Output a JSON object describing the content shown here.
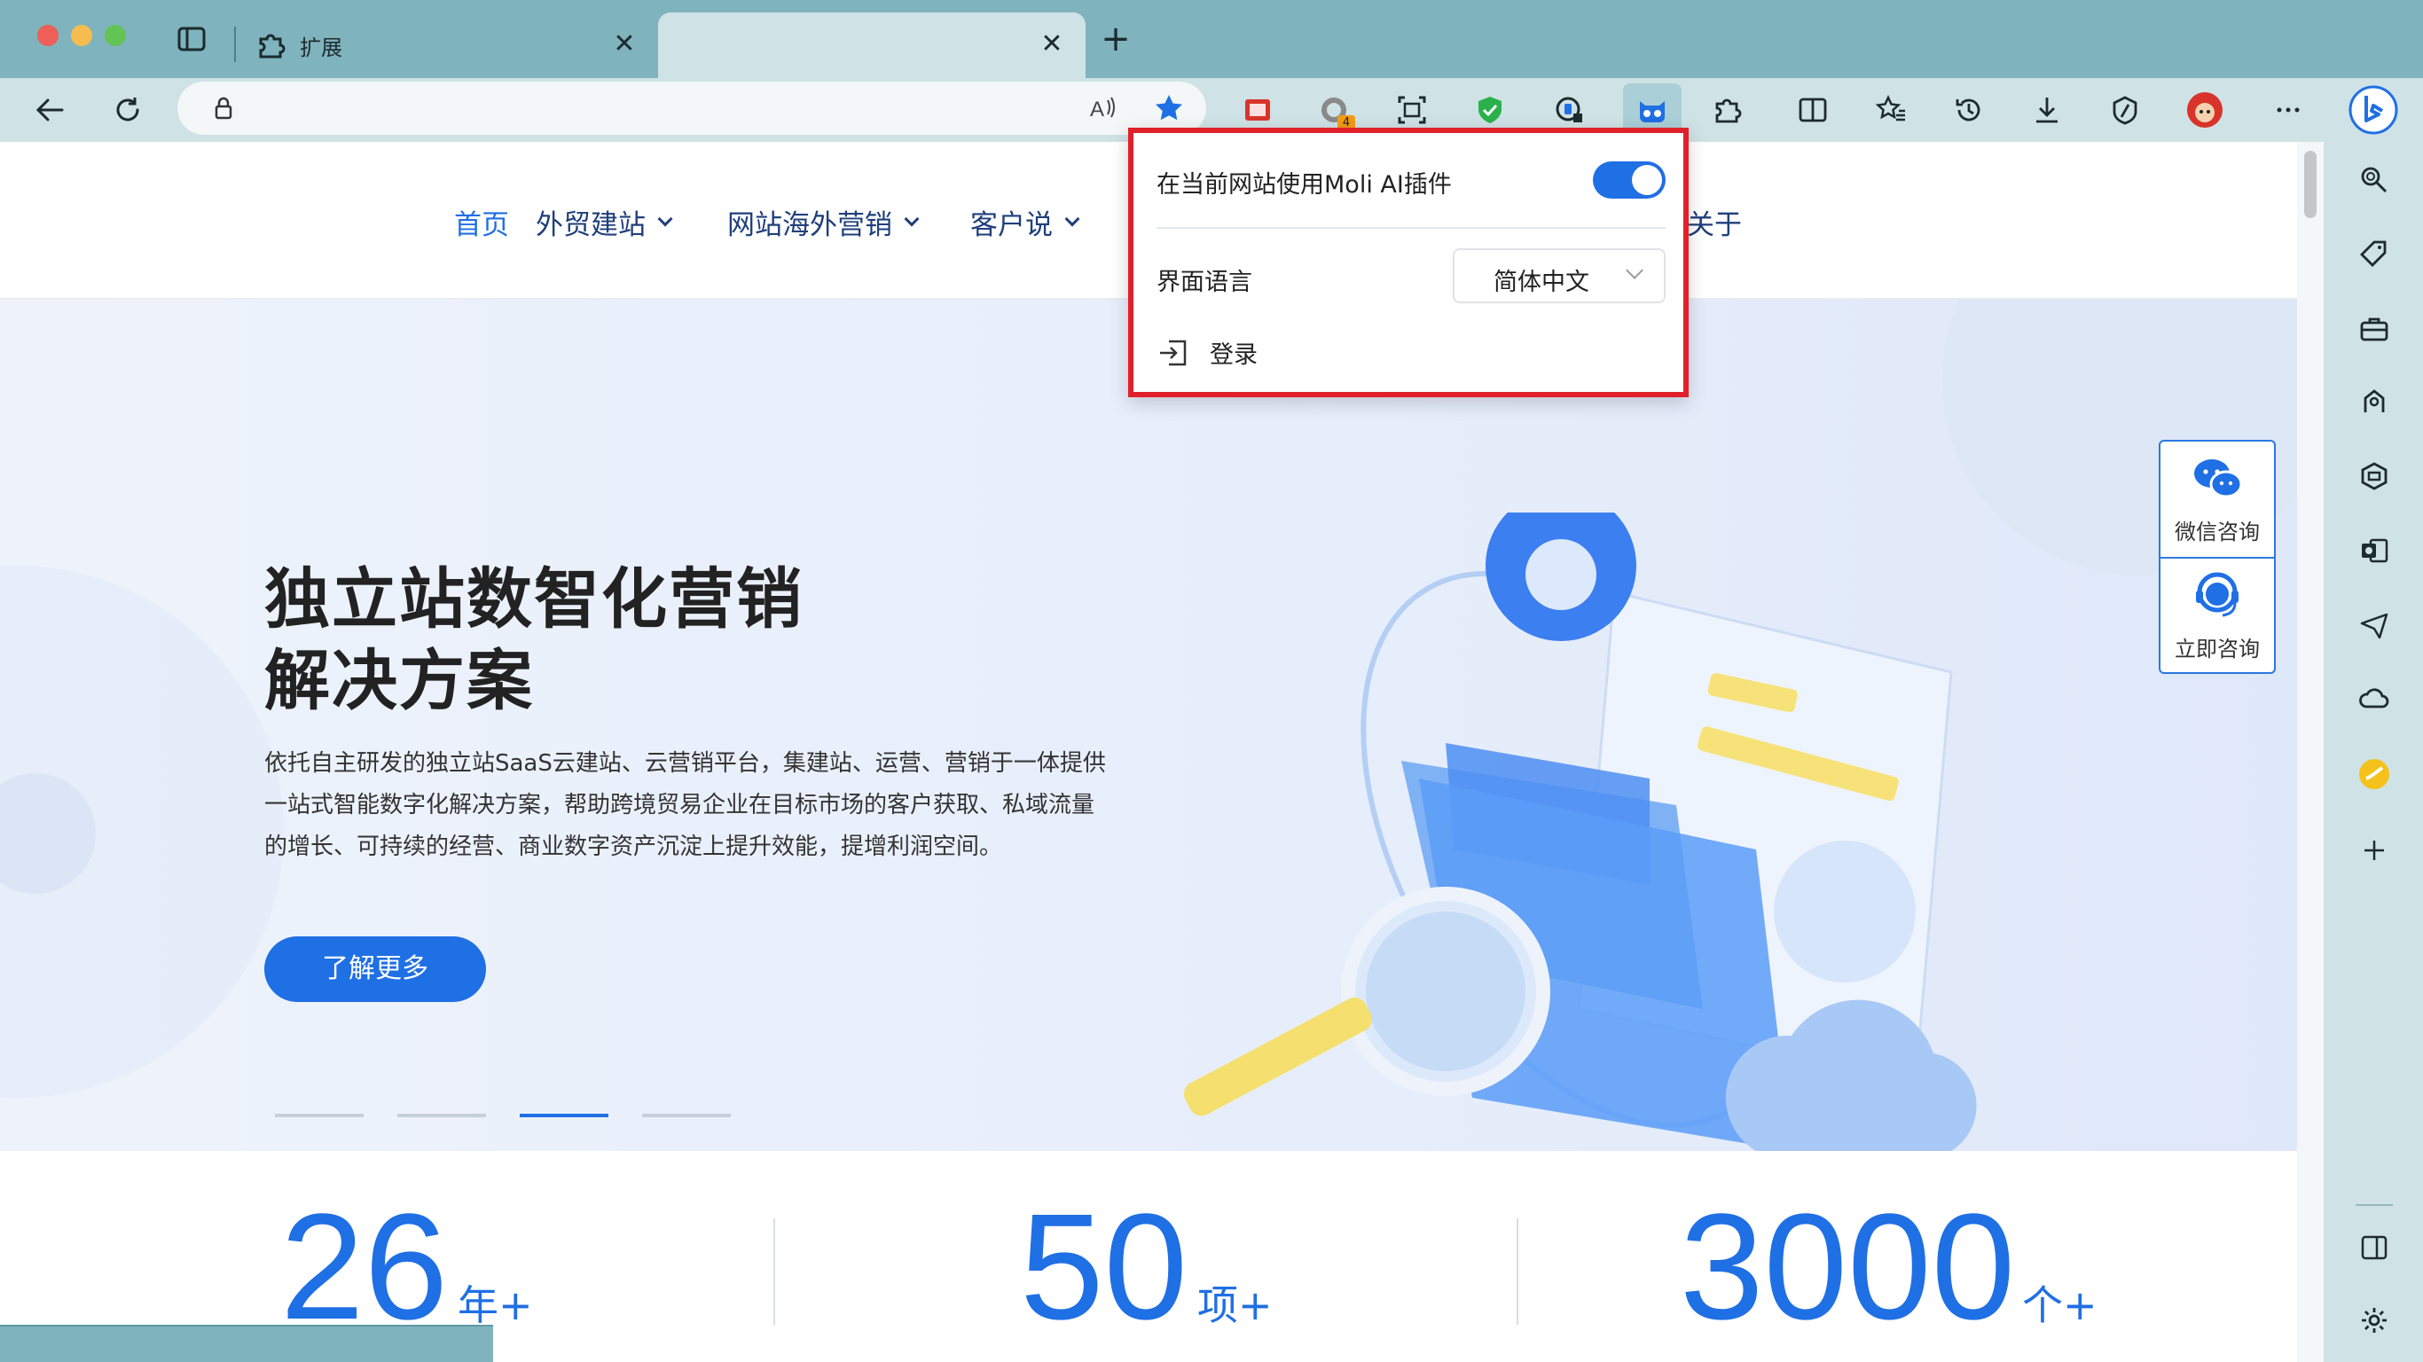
{
  "window": {
    "tabs": [
      {
        "title": "扩展",
        "icon": "puzzle-icon"
      },
      {
        "title": "",
        "icon": ""
      }
    ]
  },
  "toolbar": {
    "address_value": "",
    "extension_badge": "4",
    "icons": [
      "back-icon",
      "refresh-icon",
      "lock-icon",
      "read-aloud-icon",
      "favorite-star-icon",
      "extension-red-icon",
      "extension-circle-icon",
      "screenshot-icon",
      "shield-check-icon",
      "password-icon",
      "moli-ai-icon",
      "extensions-icon",
      "split-screen-icon",
      "favorites-icon",
      "history-icon",
      "download-icon",
      "performance-icon",
      "profile-avatar-icon",
      "more-icon",
      "bing-copilot-icon"
    ]
  },
  "sidebar": {
    "icons": [
      "search-icon",
      "tag-icon",
      "briefcase-icon",
      "games-icon",
      "office-icon",
      "outlook-icon",
      "send-icon",
      "cloud-icon",
      "app-yellow-icon",
      "add-icon",
      "sidebar-toggle-icon",
      "settings-icon"
    ]
  },
  "nav": {
    "items": [
      {
        "label": "首页",
        "active": true
      },
      {
        "label": "外贸建站",
        "dropdown": true
      },
      {
        "label": "网站海外营销",
        "dropdown": true
      },
      {
        "label": "客户说",
        "dropdown": true
      },
      {
        "label": "关于"
      }
    ]
  },
  "hero": {
    "title_line1": "独立站数智化营销",
    "title_line2": "解决方案",
    "desc_line1": "依托自主研发的独立站SaaS云建站、云营销平台，集建站、运营、营销于一体提供",
    "desc_line2": "一站式智能数字化解决方案，帮助跨境贸易企业在目标市场的客户获取、私域流量",
    "desc_line3": "的增长、可持续的经营、商业数字资产沉淀上提升效能，提增利润空间。",
    "button": "了解更多",
    "slide_count": 4,
    "active_slide": 3
  },
  "float_panel": {
    "wechat": "微信咨询",
    "consult": "立即咨询"
  },
  "stats": [
    {
      "number": "26",
      "unit": "年+"
    },
    {
      "number": "50",
      "unit": "项+"
    },
    {
      "number": "3000",
      "unit": "个+"
    }
  ],
  "popup": {
    "toggle_label": "在当前网站使用Moli AI插件",
    "toggle_on": true,
    "language_label": "界面语言",
    "language_value": "简体中文",
    "login": "登录"
  },
  "colors": {
    "accent": "#1f6fe5",
    "highlight_border": "#e0202a",
    "chrome": "#7fb3bd"
  }
}
